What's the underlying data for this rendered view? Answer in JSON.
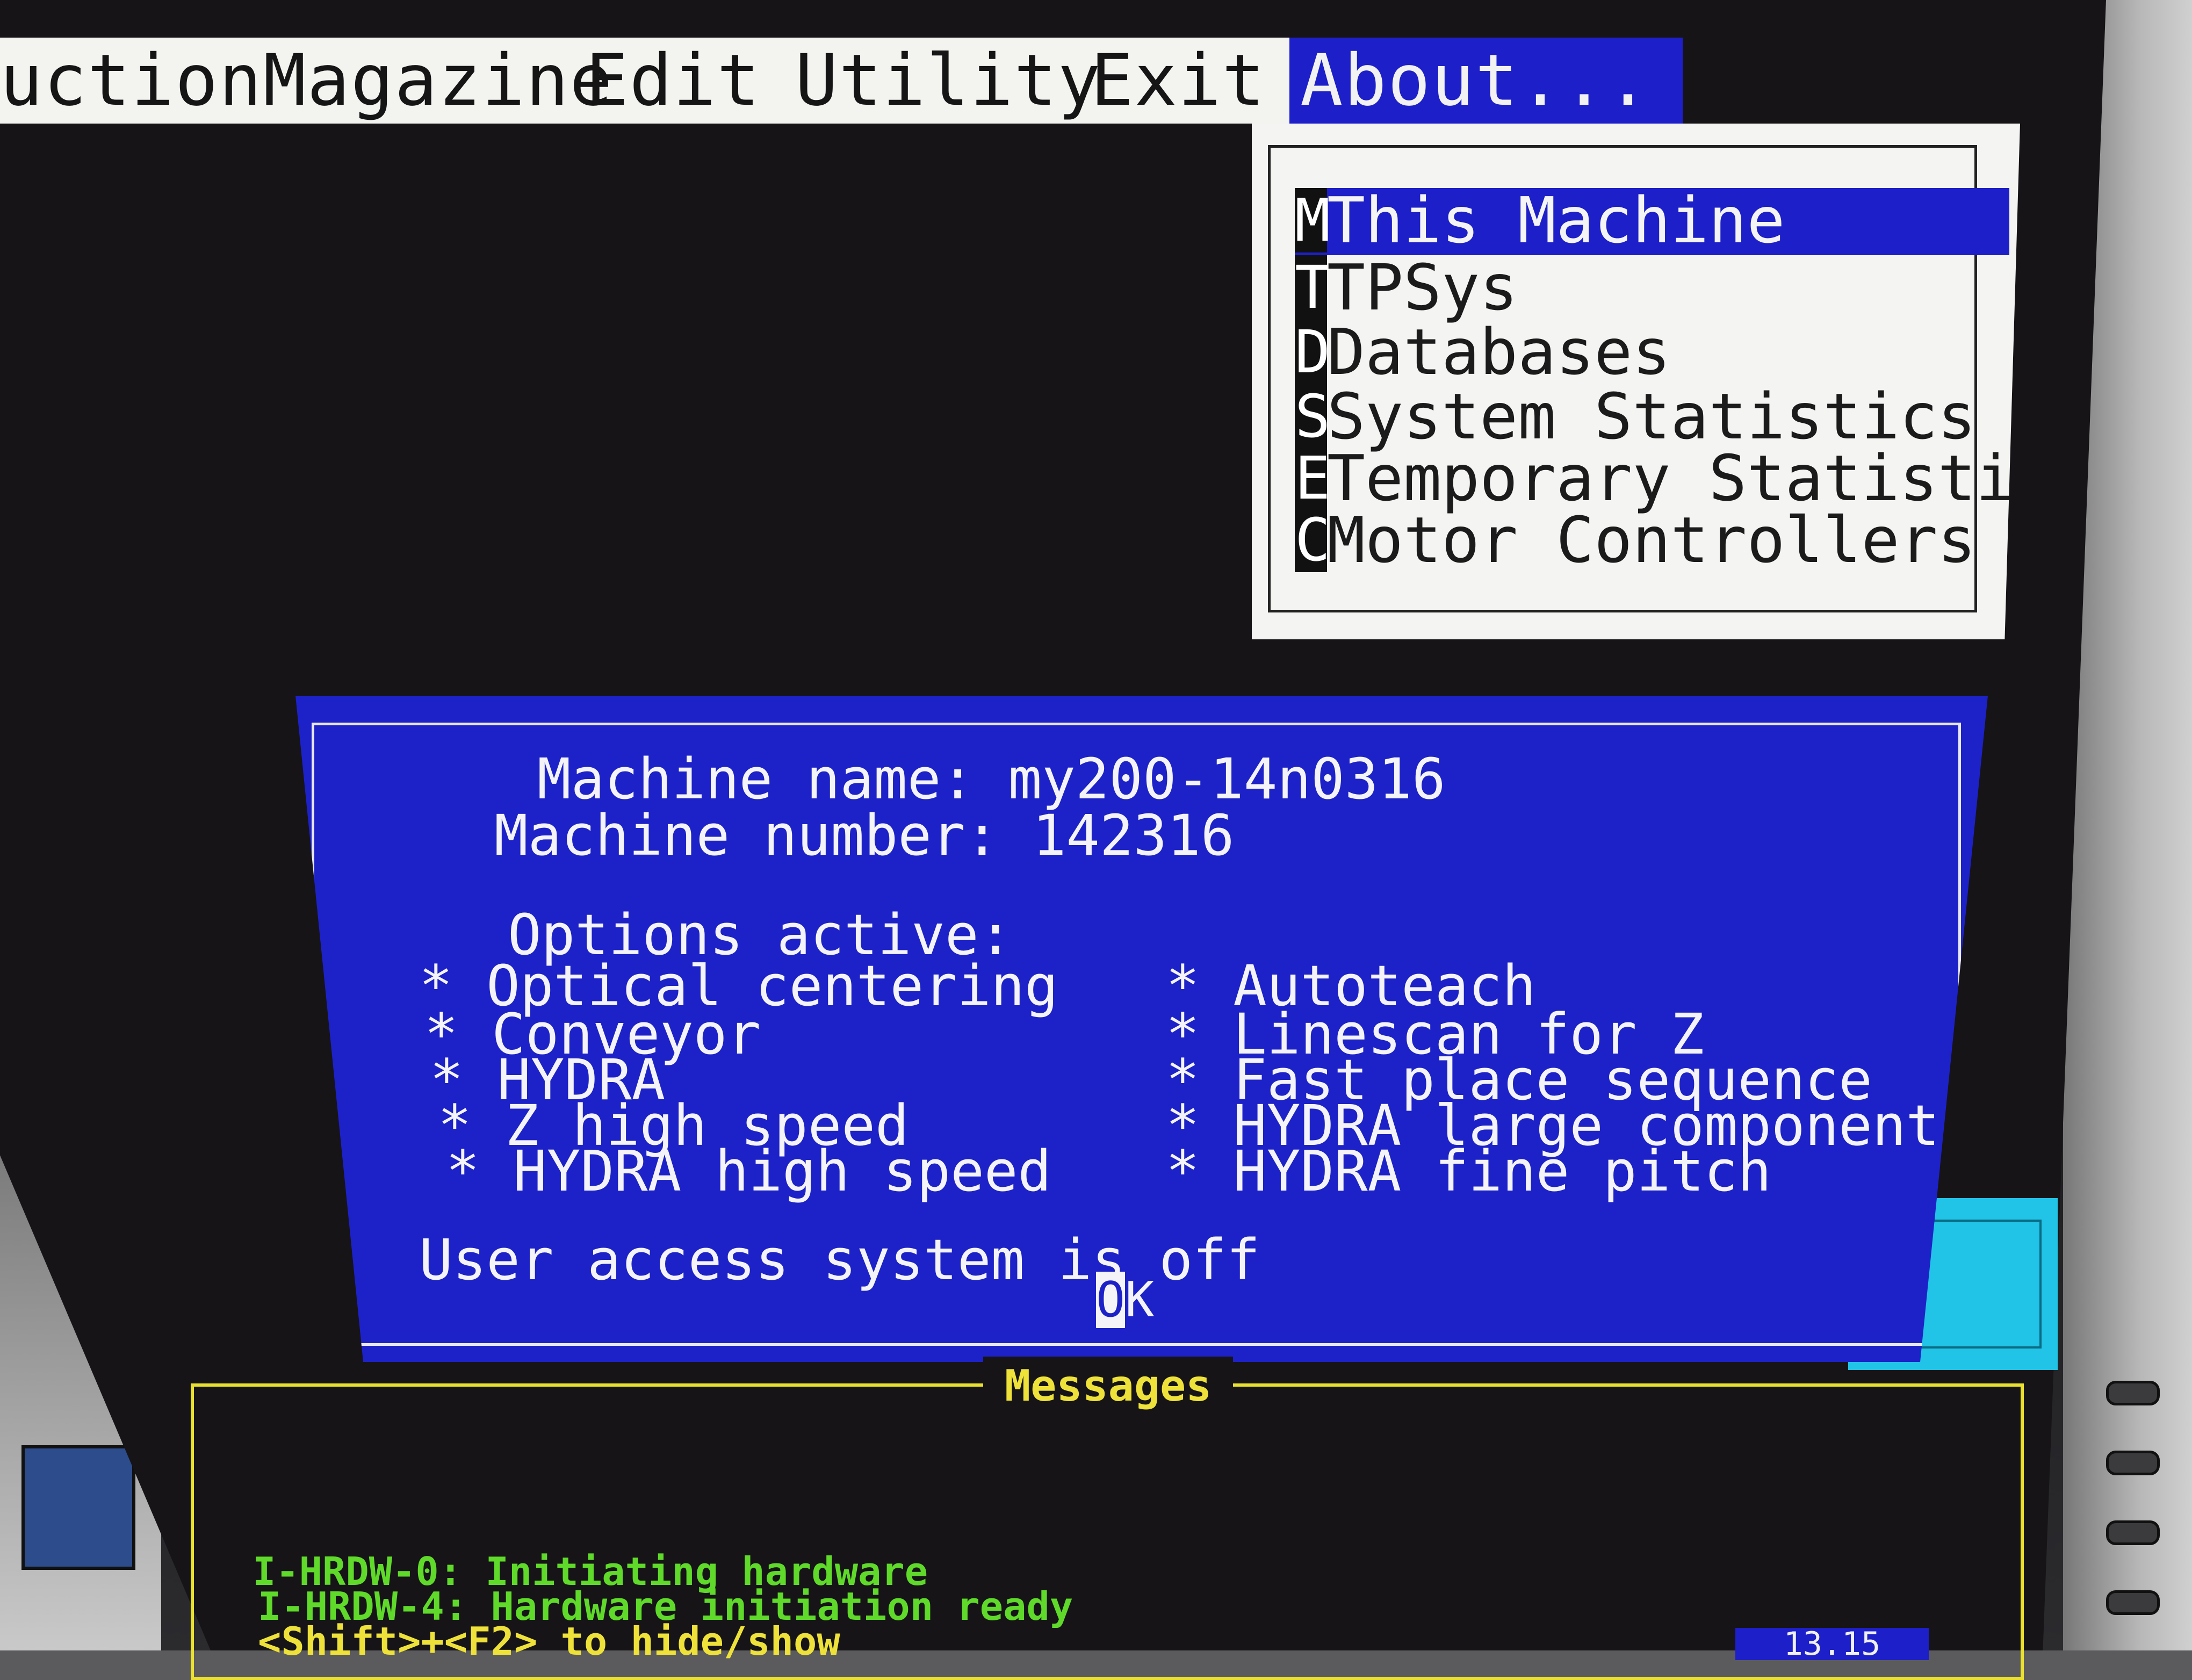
{
  "menubar": {
    "items": [
      {
        "label": "uction"
      },
      {
        "label": "Magazine"
      },
      {
        "label": "Edit"
      },
      {
        "label": "Utility"
      },
      {
        "label": "Exit"
      },
      {
        "label": "About..."
      }
    ]
  },
  "about_menu": {
    "items": [
      {
        "hotkey": "M",
        "label": "This Machine"
      },
      {
        "hotkey": "T",
        "label": "TPSys"
      },
      {
        "hotkey": "D",
        "label": "Databases"
      },
      {
        "hotkey": "S",
        "label": "System Statistics"
      },
      {
        "hotkey": "E",
        "label": "Temporary Statistics"
      },
      {
        "hotkey": "C",
        "label": "Motor Controllers"
      }
    ]
  },
  "info_dialog": {
    "machine_name": "Machine name: my200-14n0316",
    "machine_number": "Machine number: 142316",
    "options_title": "Options active:",
    "options_left": [
      "* Optical centering",
      "* Conveyor",
      "* HYDRA",
      "* Z high speed",
      "* HYDRA high speed"
    ],
    "options_right": [
      "* Autoteach",
      "* Linescan for Z",
      "* Fast place sequence",
      "* HYDRA large component range",
      "* HYDRA fine pitch"
    ],
    "user_access": "User access system is off",
    "ok_hot": "O",
    "ok_rest": "K"
  },
  "messages": {
    "title": "Messages",
    "lines": [
      "I-HRDW-0: Initiating hardware",
      "I-HRDW-4: Hardware initiation ready"
    ],
    "hint": "<Shift>+<F2> to hide/show",
    "clock": "13.15"
  },
  "colors": {
    "dialog_blue": "#1d22c8",
    "menu_highlight": "#1d1fc9",
    "messages_border": "#e9e030",
    "message_text": "#5fd92a",
    "cyan_panel": "#21c4e6"
  }
}
